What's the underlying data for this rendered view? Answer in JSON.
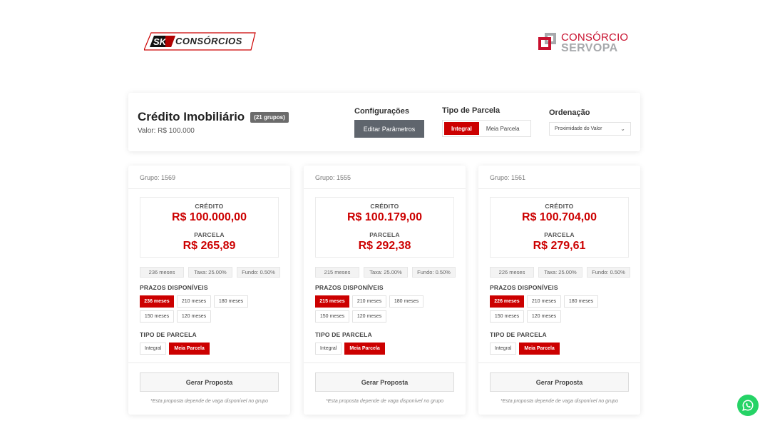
{
  "logos": {
    "left_brand": "CONSÓRCIOS",
    "right_brand_line1": "CONSÓRCIO",
    "right_brand_line2": "SERVOPA"
  },
  "header": {
    "title": "Crédito Imobiliário",
    "groups_badge": "(21 grupos)",
    "valor": "Valor: R$ 100.000",
    "config_label": "Configurações",
    "edit_button": "Editar Parâmetros",
    "tipo_label": "Tipo de Parcela",
    "tipo_options": [
      "Integral",
      "Meia Parcela"
    ],
    "tipo_selected": "Integral",
    "ordenacao_label": "Ordenação",
    "ordenacao_value": "Proximidade do Valor"
  },
  "cards": [
    {
      "grupo": "Grupo: 1569",
      "credito_label": "CRÉDITO",
      "credito_value": "R$ 100.000,00",
      "parcela_label": "PARCELA",
      "parcela_value": "R$ 265,89",
      "chips": [
        "236 meses",
        "Taxa: 25.00%",
        "Fundo: 0.50%"
      ],
      "prazos_label": "PRAZOS DISPONÍVEIS",
      "prazos": [
        "236 meses",
        "210 meses",
        "180 meses",
        "150 meses",
        "120 meses"
      ],
      "prazo_selected": "236 meses",
      "tipo_label": "TIPO DE PARCELA",
      "tipo_options": [
        "Integral",
        "Meia Parcela"
      ],
      "tipo_selected": "Meia Parcela",
      "button": "Gerar Proposta",
      "note": "*Esta proposta depende de vaga disponível no grupo"
    },
    {
      "grupo": "Grupo: 1555",
      "credito_label": "CRÉDITO",
      "credito_value": "R$ 100.179,00",
      "parcela_label": "PARCELA",
      "parcela_value": "R$ 292,38",
      "chips": [
        "215 meses",
        "Taxa: 25.00%",
        "Fundo: 0.50%"
      ],
      "prazos_label": "PRAZOS DISPONÍVEIS",
      "prazos": [
        "215 meses",
        "210 meses",
        "180 meses",
        "150 meses",
        "120 meses"
      ],
      "prazo_selected": "215 meses",
      "tipo_label": "TIPO DE PARCELA",
      "tipo_options": [
        "Integral",
        "Meia Parcela"
      ],
      "tipo_selected": "Meia Parcela",
      "button": "Gerar Proposta",
      "note": "*Esta proposta depende de vaga disponível no grupo"
    },
    {
      "grupo": "Grupo: 1561",
      "credito_label": "CRÉDITO",
      "credito_value": "R$ 100.704,00",
      "parcela_label": "PARCELA",
      "parcela_value": "R$ 279,61",
      "chips": [
        "226 meses",
        "Taxa: 25.00%",
        "Fundo: 0.50%"
      ],
      "prazos_label": "PRAZOS DISPONÍVEIS",
      "prazos": [
        "226 meses",
        "210 meses",
        "180 meses",
        "150 meses",
        "120 meses"
      ],
      "prazo_selected": "226 meses",
      "tipo_label": "TIPO DE PARCELA",
      "tipo_options": [
        "Integral",
        "Meia Parcela"
      ],
      "tipo_selected": "Meia Parcela",
      "button": "Gerar Proposta",
      "note": "*Esta proposta depende de vaga disponível no grupo"
    }
  ],
  "colors": {
    "accent": "#cc0000",
    "whatsapp": "#25d366"
  },
  "icons": [
    "sk-logo-icon",
    "servopa-logo-icon",
    "chevron-down-icon",
    "whatsapp-icon"
  ]
}
